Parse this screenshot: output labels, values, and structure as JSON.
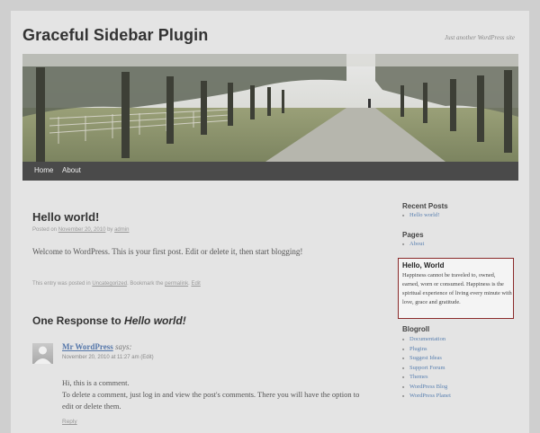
{
  "site": {
    "title": "Graceful Sidebar Plugin",
    "tagline": "Just another WordPress site"
  },
  "nav": {
    "items": [
      {
        "label": "Home"
      },
      {
        "label": "About"
      }
    ]
  },
  "post": {
    "title": "Hello world!",
    "posted_on_label": "Posted on",
    "date": "November 20, 2010",
    "by_label": "by",
    "author": "admin",
    "body": "Welcome to WordPress. This is your first post. Edit or delete it, then start blogging!",
    "footer_prefix": "This entry was posted in",
    "category": "Uncategorized",
    "bookmark_label": ". Bookmark the",
    "permalink_label": "permalink",
    "edit_label": "Edit"
  },
  "responses": {
    "title_prefix": "One Response to",
    "title_post": "Hello world!",
    "comment": {
      "author": "Mr WordPress",
      "says": "says:",
      "date": "November 20, 2010 at 11:27 am",
      "edit_label": "(Edit)",
      "line1": "Hi, this is a comment.",
      "line2": "To delete a comment, just log in and view the post's comments. There you will have the option to edit or delete them.",
      "reply_label": "Reply"
    }
  },
  "sidebar": {
    "recent_posts": {
      "title": "Recent Posts",
      "items": [
        "Hello world!"
      ]
    },
    "pages": {
      "title": "Pages",
      "items": [
        "About"
      ]
    },
    "quote": {
      "title": "Hello, World",
      "body": "Happiness cannot be traveled to, owned, earned, worn or consumed. Happiness is the spiritual experience of living every minute with love, grace and gratitude."
    },
    "blogroll": {
      "title": "Blogroll",
      "items": [
        "Documentation",
        "Plugins",
        "Suggest Ideas",
        "Support Forum",
        "Themes",
        "WordPress Blog",
        "WordPress Planet"
      ]
    }
  },
  "colors": {
    "link": "#5a80b0",
    "quote_border": "#8a2a2a",
    "nav_bg": "#4a4a4a"
  }
}
